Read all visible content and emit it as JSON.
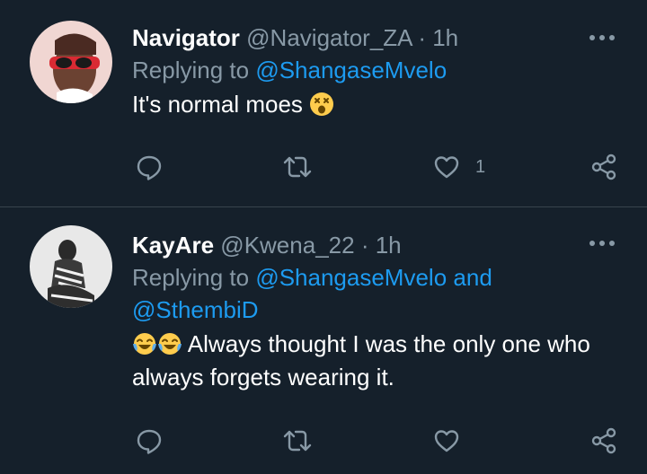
{
  "tweets": [
    {
      "display_name": "Navigator",
      "handle": "@Navigator_ZA",
      "separator": "·",
      "time": "1h",
      "replying_prefix": "Replying to",
      "replying_to": [
        "@ShangaseMvelo"
      ],
      "replying_joiner": "",
      "text": "It's normal moes",
      "text_emoji": "astonished-face",
      "actions": {
        "reply_count": "",
        "retweet_count": "",
        "like_count": "1"
      },
      "avatar": "avatar-navigator"
    },
    {
      "display_name": "KayAre",
      "handle": "@Kwena_22",
      "separator": "·",
      "time": "1h",
      "replying_prefix": "Replying to",
      "replying_to": [
        "@ShangaseMvelo",
        "@SthembiD"
      ],
      "replying_joiner": "and",
      "text": "Always thought I was the only one who always forgets wearing it.",
      "text_leading_emojis": [
        "tears-of-joy-face",
        "tears-of-joy-face"
      ],
      "actions": {
        "reply_count": "",
        "retweet_count": "",
        "like_count": ""
      },
      "avatar": "avatar-kayare"
    }
  ],
  "colors": {
    "background": "#15202b",
    "text": "#ffffff",
    "secondary": "#8899a6",
    "link": "#1d9bf0",
    "divider": "#38444d"
  }
}
